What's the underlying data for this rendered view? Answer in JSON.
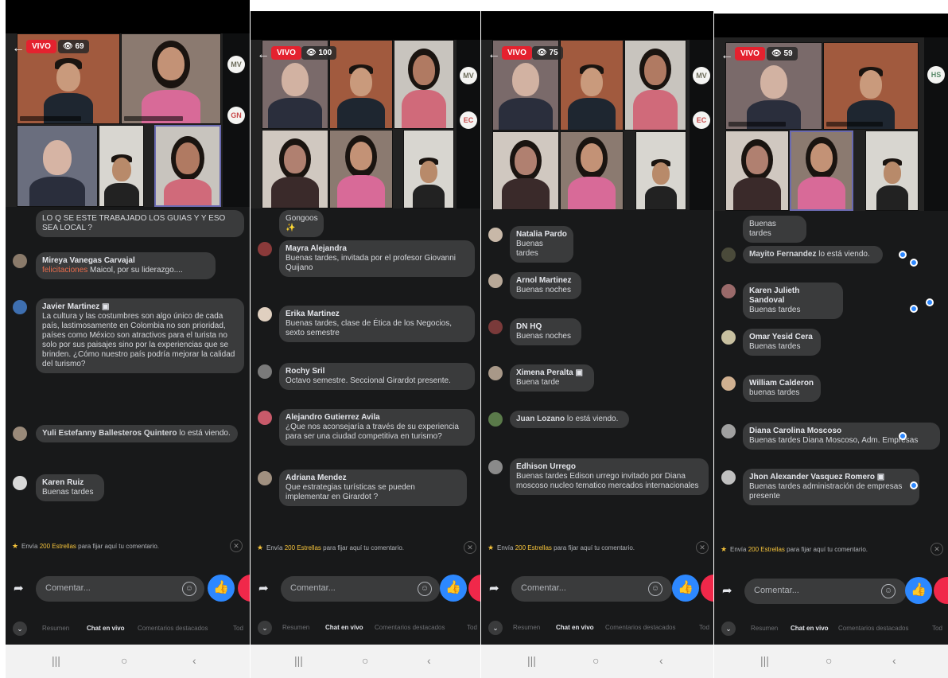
{
  "colors": {
    "background": "#18191a",
    "bubble": "#3a3b3c",
    "live": "#e4222f",
    "like": "#2d88ff",
    "heart": "#f0284a",
    "stars": "#f5c33b"
  },
  "panels": [
    {
      "live_label": "VIVO",
      "viewers": "69",
      "side_participants": [
        "MV",
        "GN"
      ],
      "comments": [
        {
          "avatar_color": "#3a3b3c",
          "name": "",
          "text": "LO Q SE ESTE TRABAJADO LOS GUIAS Y Y ESO SEA LOCAL ?",
          "inline": false
        },
        {
          "avatar_color": "#8a7a6a",
          "name": "Mireya Vanegas Carvajal",
          "text_highlight": "felicitaciones",
          "text": " Maicol, por su liderazgo....",
          "inline": false
        },
        {
          "avatar_color": "#3e6fb0",
          "name": "Javier Martinez",
          "text": "La cultura y las costumbres son algo único de cada país, lastimosamente en Colombia no son prioridad, países como México son atractivos para el turista no solo por sus paisajes sino por la experiencias que se brinden. ¿Cómo nuestro país podría mejorar la calidad del turismo?",
          "inline": false
        },
        {
          "avatar_color": "#9a8a7a",
          "name": "Yuli Estefanny Ballesteros Quintero",
          "text": "lo está viendo.",
          "inline": true
        },
        {
          "avatar_color": "#d8d8d8",
          "name": "Karen Ruiz",
          "text": "Buenas tardes",
          "inline": false
        }
      ],
      "pin": {
        "prefix": "Envía ",
        "stars": "200 Estrellas",
        "suffix": " para fijar aquí tu comentario."
      },
      "composer_placeholder": "Comentar...",
      "tabs": [
        "Resumen",
        "Chat en vivo",
        "Comentarios destacados",
        "Tod"
      ]
    },
    {
      "live_label": "VIVO",
      "viewers": "100",
      "side_participants": [
        "MV",
        "EC"
      ],
      "comments": [
        {
          "avatar_color": "#3a3b3c",
          "name": "",
          "text": "Gongoos ✨",
          "inline": false
        },
        {
          "avatar_color": "#8a3a3a",
          "name": "Mayra Alejandra",
          "text": "Buenas tardes, invitada por el profesor Giovanni Quijano",
          "inline": false
        },
        {
          "avatar_color": "#e0d0c0",
          "name": "Erika Martinez",
          "text": "Buenas tardes, clase de Ética de los Negocios, sexto semestre",
          "inline": false
        },
        {
          "avatar_color": "#7a7a7a",
          "name": "Rochy Sril",
          "text": "Octavo semestre.  Seccional Girardot presente.",
          "inline": false
        },
        {
          "avatar_color": "#c85a6a",
          "name": "Alejandro Gutierrez Avila",
          "text": "¿Que nos aconsejaría a través de su experiencia para ser una ciudad competitiva en turismo?",
          "inline": false
        },
        {
          "avatar_color": "#a09080",
          "name": "Adriana Mendez",
          "text": "Que estrategias turísticas se pueden implementar en Girardot ?",
          "inline": false
        }
      ],
      "pin": {
        "prefix": "Envía ",
        "stars": "200 Estrellas",
        "suffix": " para fijar aquí tu comentario."
      },
      "composer_placeholder": "Comentar...",
      "tabs": [
        "Resumen",
        "Chat en vivo",
        "Comentarios destacados",
        "Tod"
      ]
    },
    {
      "live_label": "VIVO",
      "viewers": "75",
      "side_participants": [
        "MV",
        "EC"
      ],
      "comments": [
        {
          "avatar_color": "#c8b8a8",
          "name": "Natalia Pardo",
          "text": "Buenas tardes",
          "inline": false
        },
        {
          "avatar_color": "#b8a898",
          "name": "Arnol Martinez",
          "text": "Buenas noches",
          "inline": false
        },
        {
          "avatar_color": "#7a3a3a",
          "name": "DN HQ",
          "text": "Buenas noches",
          "inline": false
        },
        {
          "avatar_color": "#a89888",
          "name": "Ximena Peralta",
          "text": "Buena tarde",
          "inline": false
        },
        {
          "avatar_color": "#5a7a4a",
          "name": "Juan Lozano",
          "text": "lo está viendo.",
          "inline": true
        },
        {
          "avatar_color": "#8a8a8a",
          "name": "Edhison Urrego",
          "text": "Buenas tardes Edison urrego  invitado por Diana moscoso nucleo tematico mercados internacionales",
          "inline": false
        }
      ],
      "pin": {
        "prefix": "Envía ",
        "stars": "200 Estrellas",
        "suffix": " para fijar aquí tu comentario."
      },
      "composer_placeholder": "Comentar...",
      "tabs": [
        "Resumen",
        "Chat en vivo",
        "Comentarios destacados",
        "Tod"
      ]
    },
    {
      "live_label": "VIVO",
      "viewers": "59",
      "side_participants": [
        "HS"
      ],
      "comments": [
        {
          "avatar_color": "#3a3b3c",
          "name": "",
          "text": "Buenas tardes",
          "inline": false
        },
        {
          "avatar_color": "#4a4a3a",
          "name": "Mayito Fernandez",
          "text": "lo está viendo.",
          "inline": true
        },
        {
          "avatar_color": "#9a6a6a",
          "name": "Karen Julieth Sandoval",
          "text": "Buenas tardes",
          "inline": false
        },
        {
          "avatar_color": "#c8c0a0",
          "name": "Omar Yesid Cera",
          "text": "Buenas tardes",
          "inline": false
        },
        {
          "avatar_color": "#d0b090",
          "name": "William Calderon",
          "text": "buenas tardes",
          "inline": false
        },
        {
          "avatar_color": "#a0a0a0",
          "name": "Diana Carolina Moscoso",
          "text": "Buenas tardes Diana Moscoso, Adm. Empresas",
          "inline": false
        },
        {
          "avatar_color": "#c0c0c0",
          "name": "Jhon Alexander Vasquez Romero",
          "text": "Buenas tardes administración de empresas presente",
          "inline": false
        }
      ],
      "pin": {
        "prefix": "Envía ",
        "stars": "200 Estrellas",
        "suffix": " para fijar aquí tu comentario."
      },
      "composer_placeholder": "Comentar...",
      "tabs": [
        "Resumen",
        "Chat en vivo",
        "Comentarios destacados",
        "Tod"
      ]
    }
  ],
  "navbar": {
    "recent": "|||",
    "home": "○",
    "back": "‹"
  }
}
